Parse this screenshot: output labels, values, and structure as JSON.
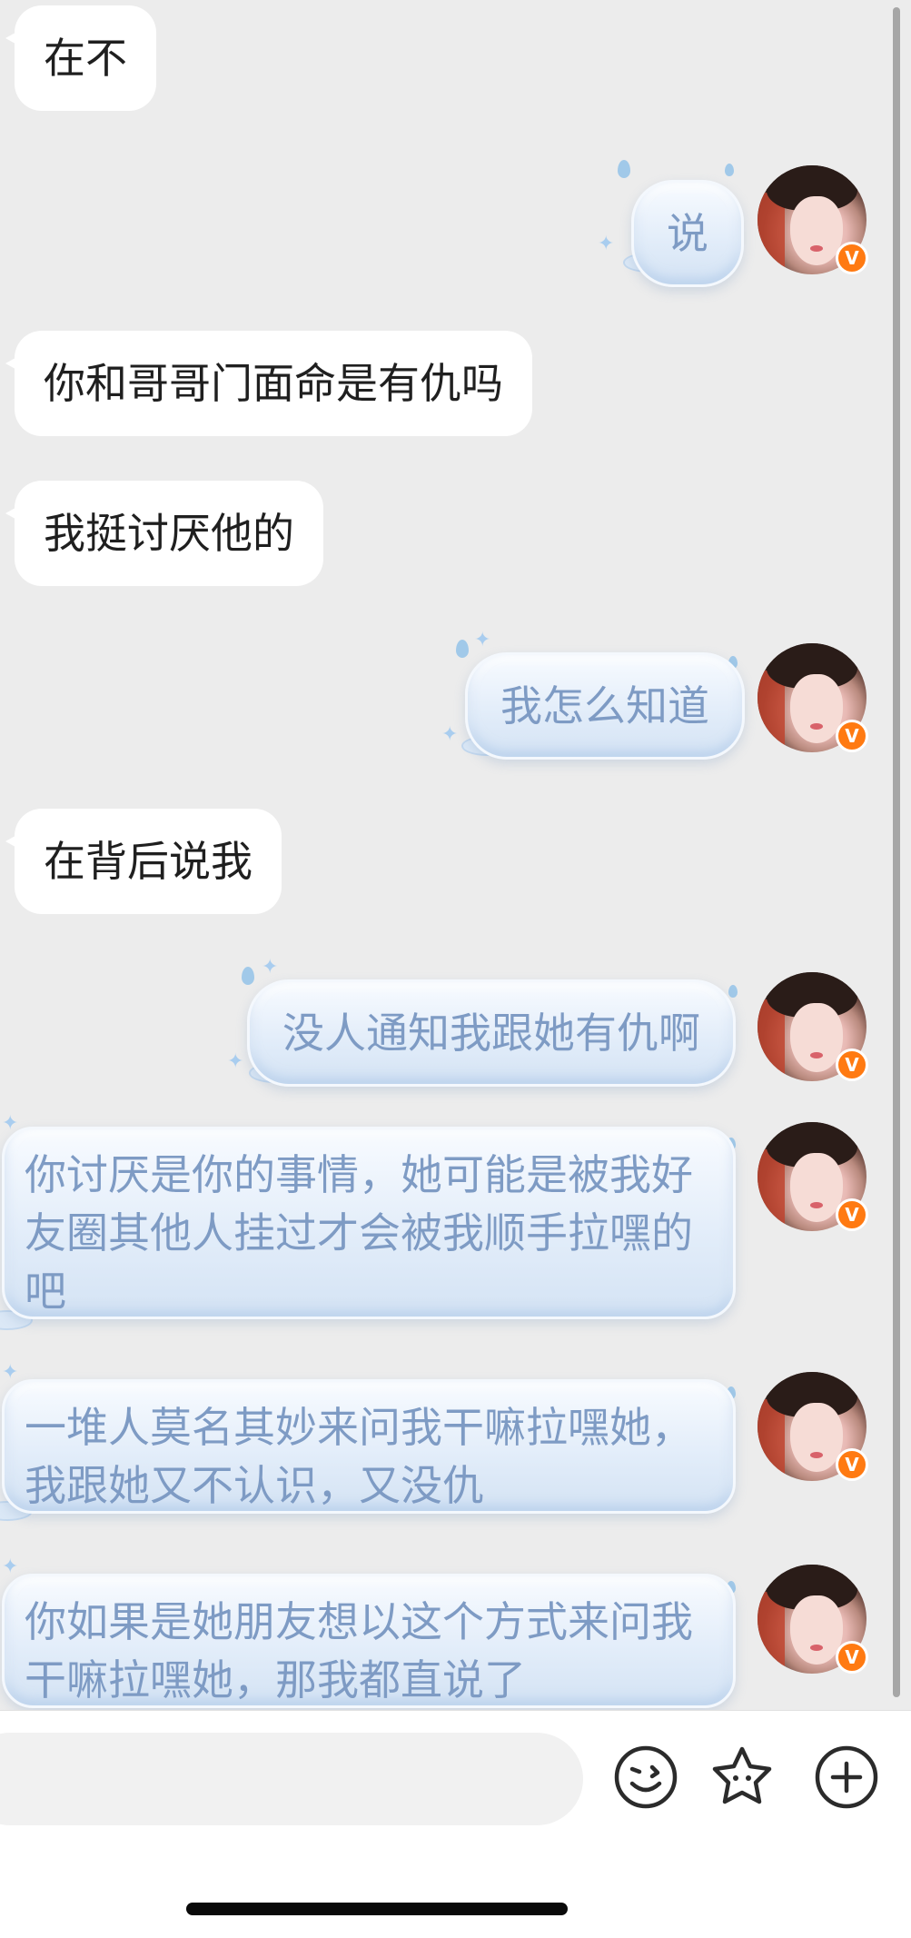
{
  "chat": {
    "messages": [
      {
        "from": "other",
        "text": "在不"
      },
      {
        "from": "me",
        "text": "说"
      },
      {
        "from": "other",
        "text": "你和哥哥门面命是有仇吗"
      },
      {
        "from": "other",
        "text": "我挺讨厌他的"
      },
      {
        "from": "me",
        "text": "我怎么知道"
      },
      {
        "from": "other",
        "text": "在背后说我"
      },
      {
        "from": "me",
        "text": "没人通知我跟她有仇啊"
      },
      {
        "from": "me",
        "text": "你讨厌是你的事情，她可能是被我好友圈其他人挂过才会被我顺手拉嘿的吧"
      },
      {
        "from": "me",
        "text": "一堆人莫名其妙来问我干嘛拉嘿她，我跟她又不认识，又没仇"
      },
      {
        "from": "me",
        "text": "你如果是她朋友想以这个方式来问我干嘛拉嘿她，那我都直说了"
      }
    ],
    "avatar_badge": "V"
  },
  "input": {
    "placeholder": ""
  },
  "toolbar": {
    "emoji_icon": "smiley-face-icon",
    "sticker_icon": "star-sticker-icon",
    "more_icon": "plus-circle-icon"
  },
  "colors": {
    "chat_background": "#ececec",
    "incoming_bubble": "#ffffff",
    "outgoing_text": "#7e9bc4",
    "badge": "#ff7a12"
  }
}
